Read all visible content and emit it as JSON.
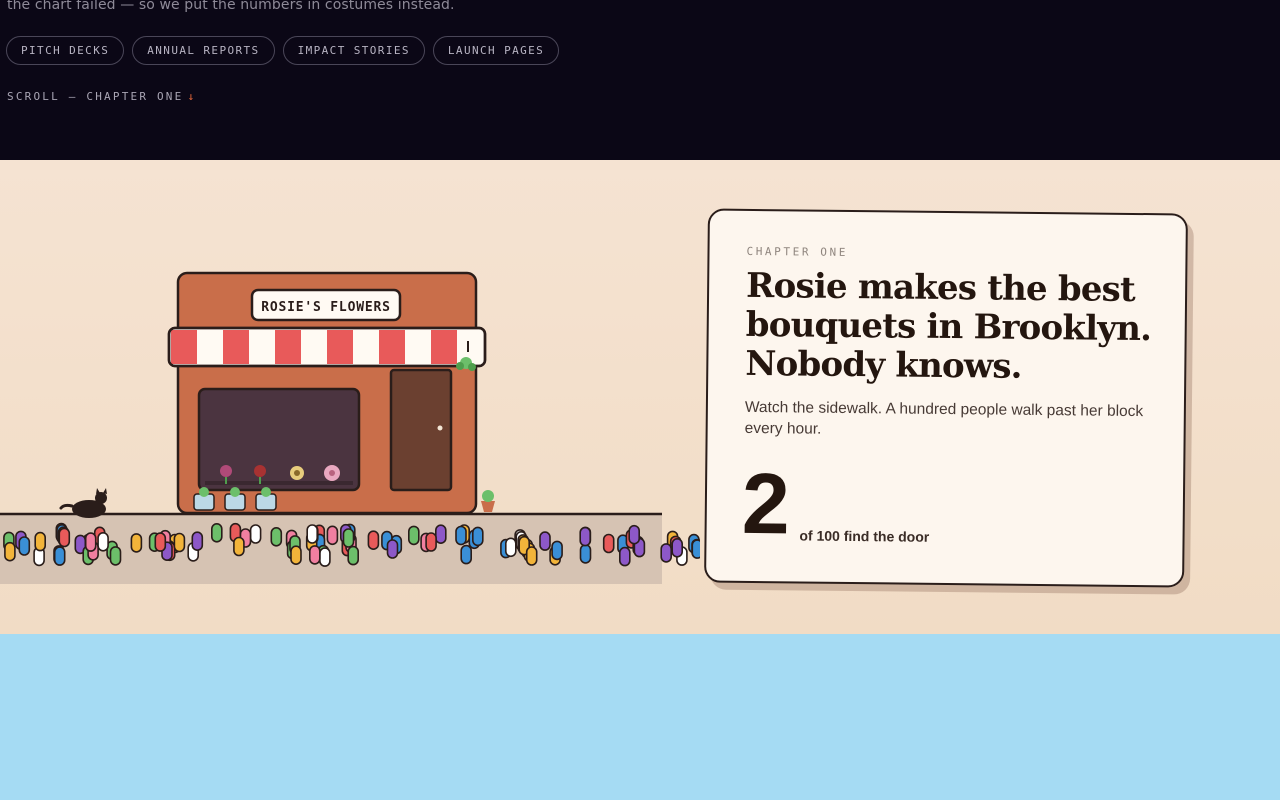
{
  "hero": {
    "tagline": "the chart failed — so we put the numbers in costumes instead.",
    "chips": [
      {
        "label": "PITCH DECKS"
      },
      {
        "label": "ANNUAL REPORTS"
      },
      {
        "label": "IMPACT STORIES"
      },
      {
        "label": "LAUNCH PAGES"
      }
    ],
    "scroll_cue": "SCROLL — CHAPTER ONE",
    "scroll_arrow": "↓"
  },
  "scene": {
    "shop_sign": "ROSIE'S FLOWERS",
    "pedestrians_total": 100,
    "pedestrians_entering": 2,
    "pedestrian_colors": [
      "#e85a5a",
      "#3a8fd6",
      "#8d58c8",
      "#f2b43a",
      "#6cbf6a",
      "#f07fa0",
      "#ffffff"
    ],
    "icons": [
      "cat-icon",
      "flower-icon",
      "potted-plant-icon",
      "hanging-plant-icon",
      "door-handle-icon"
    ]
  },
  "card": {
    "eyebrow": "CHAPTER ONE",
    "title": "Rosie makes the best bouquets in Brooklyn. Nobody knows.",
    "body": "Watch the sidewalk. A hundred people walk past her block every hour.",
    "stat_number": "2",
    "stat_caption": "of 100 find the door"
  },
  "colors": {
    "hero_bg": "#0b0716",
    "scene_bg": "#f3e0cc",
    "shop": "#c96e4a",
    "awning_red": "#e85a5a",
    "door": "#6b4030",
    "card_bg": "#fdf6ee",
    "accent_arrow": "#e8683b",
    "sky": "#a5dbf3"
  }
}
